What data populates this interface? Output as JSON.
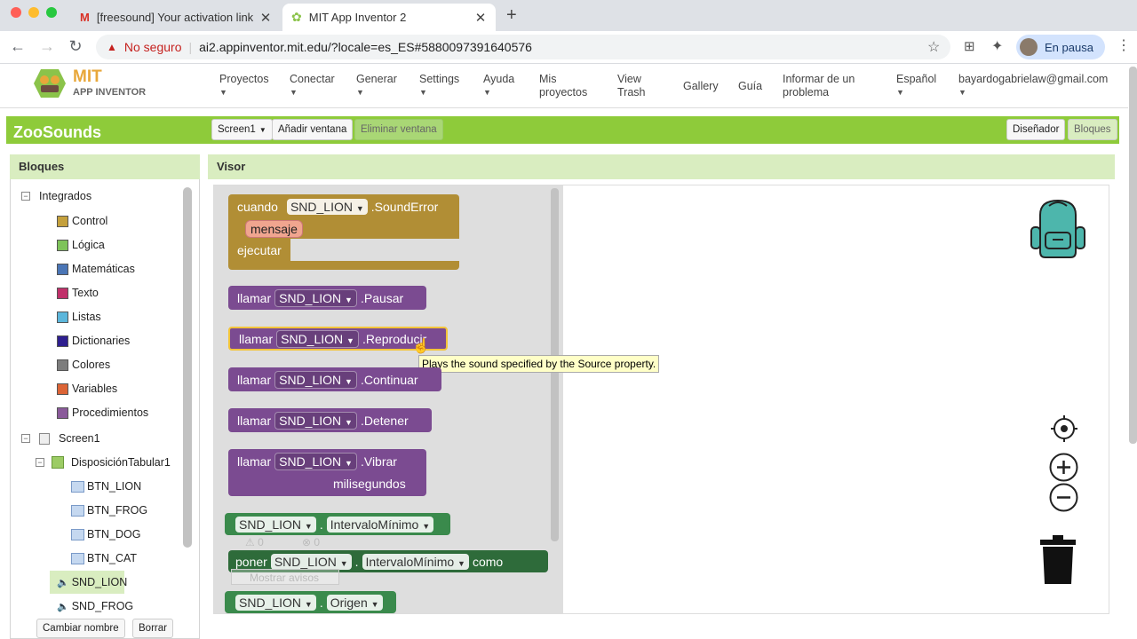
{
  "browser": {
    "tabs": [
      {
        "title": "[freesound] Your activation link"
      },
      {
        "title": "MIT App Inventor 2"
      }
    ],
    "address": {
      "warning": "No seguro",
      "url": "ai2.appinventor.mit.edu/?locale=es_ES#5880097391640576"
    },
    "profile": "En pausa"
  },
  "app": {
    "logo_line1": "MIT",
    "logo_line2": "APP INVENTOR",
    "menus": [
      "Proyectos",
      "Conectar",
      "Generar",
      "Settings",
      "Ayuda"
    ],
    "links": [
      "Mis proyectos",
      "View Trash",
      "Gallery",
      "Guía",
      "Informar de un problema"
    ],
    "language": "Español",
    "user": "bayardogabrielaw@gmail.com"
  },
  "project": {
    "name": "ZooSounds",
    "screen_select": "Screen1",
    "add_screen": "Añadir ventana",
    "remove_screen": "Eliminar ventana",
    "designer": "Diseñador",
    "blocks": "Bloques"
  },
  "blocks_panel": {
    "title": "Bloques",
    "builtin": "Integrados",
    "items": [
      {
        "label": "Control",
        "color": "#c4a03c"
      },
      {
        "label": "Lógica",
        "color": "#7ec35a"
      },
      {
        "label": "Matemáticas",
        "color": "#4a75b5"
      },
      {
        "label": "Texto",
        "color": "#c0306a"
      },
      {
        "label": "Listas",
        "color": "#5cb6db"
      },
      {
        "label": "Dictionaries",
        "color": "#2e1f8f"
      },
      {
        "label": "Colores",
        "color": "#7d7d7d"
      },
      {
        "label": "Variables",
        "color": "#dc6436"
      },
      {
        "label": "Procedimientos",
        "color": "#8a5a9a"
      }
    ],
    "screen": "Screen1",
    "arrangement": "DisposiciónTabular1",
    "components": [
      "BTN_LION",
      "BTN_FROG",
      "BTN_DOG",
      "BTN_CAT"
    ],
    "sounds": [
      "SND_LION",
      "SND_FROG"
    ],
    "rename": "Cambiar nombre",
    "delete": "Borrar"
  },
  "visor": {
    "title": "Visor",
    "event": {
      "when": "cuando",
      "comp": "SND_LION",
      "event": ".SoundError",
      "param": "mensaje",
      "do": "ejecutar"
    },
    "calls": [
      {
        "kw": "llamar",
        "comp": "SND_LION",
        "method": ".Pausar"
      },
      {
        "kw": "llamar",
        "comp": "SND_LION",
        "method": ".Reproducir"
      },
      {
        "kw": "llamar",
        "comp": "SND_LION",
        "method": ".Continuar"
      },
      {
        "kw": "llamar",
        "comp": "SND_LION",
        "method": ".Detener"
      },
      {
        "kw": "llamar",
        "comp": "SND_LION",
        "method": ".Vibrar",
        "arg": "milisegundos"
      }
    ],
    "getter1": {
      "comp": "SND_LION",
      "prop": "IntervaloMínimo"
    },
    "setter": {
      "kw": "poner",
      "comp": "SND_LION",
      "prop": "IntervaloMínimo",
      "as": "como"
    },
    "getter2": {
      "comp": "SND_LION",
      "prop": "Origen"
    },
    "tooltip": "Plays the sound specified by the Source property.",
    "warnings": "0",
    "errors": "0",
    "show_warnings": "Mostrar avisos"
  }
}
